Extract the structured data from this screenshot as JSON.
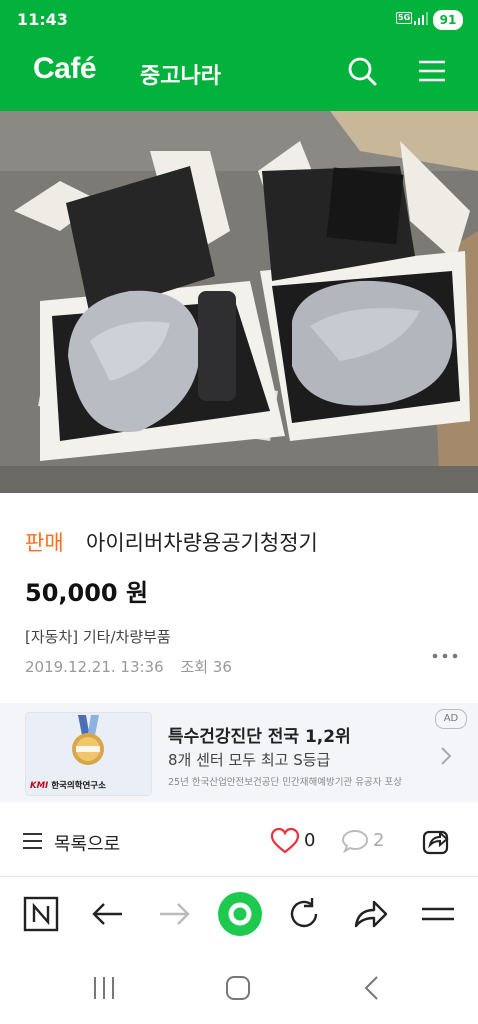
{
  "status_bar": {
    "time": "11:43",
    "network": "5G",
    "battery": "91"
  },
  "header": {
    "logo": "Café",
    "cafe_name": "중고나라",
    "search_icon": "search-icon",
    "menu_icon": "hamburger-menu-icon",
    "background_color": "#03b23c"
  },
  "post": {
    "sale_badge": "판매",
    "title": "아이리버차량용공기청정기",
    "price": "50,000 원",
    "category": "[자동차] 기타/차량부품",
    "date": "2019.12.21. 13:36",
    "views": "조회 36",
    "more_icon": "more-dots-icon"
  },
  "ad": {
    "title": "특수건강진단 전국 1,2위",
    "subtitle": "8개 센터 모두 최고 S등급",
    "small_text": "25년 한국산업안전보건공단 민간재해예방기관 유공자 포상",
    "tag": "AD",
    "logo_text_brand": "KMI",
    "logo_text": "한국의학연구소"
  },
  "actions": {
    "list_label": "목록으로",
    "like_count": "0",
    "comment_count": "2"
  },
  "toolbar": {
    "items": [
      "naver-home-icon",
      "back-arrow-icon",
      "forward-arrow-icon",
      "green-dot-icon",
      "refresh-icon",
      "share-icon",
      "menu-icon"
    ]
  },
  "system_nav": {
    "items": [
      "recent-apps-icon",
      "home-icon",
      "back-icon"
    ]
  }
}
